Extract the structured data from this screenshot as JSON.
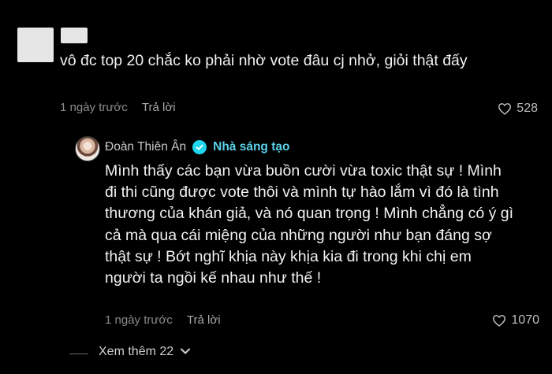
{
  "comment": {
    "text": "vô đc top 20 chắc ko phải nhờ vote đâu cj nhở, giỏi thật đấy",
    "time": "1 ngày trước",
    "reply_label": "Trả lời",
    "likes": "528",
    "like_icon": "heart-outline-icon"
  },
  "reply": {
    "author": "Đoàn Thiên Ân",
    "badge": "Nhà sáng tạo",
    "verified_icon": "verified-check-icon",
    "text": "Mình thấy các bạn vừa buồn cười vừa toxic thật sự ! Mình đi thi cũng được vote thôi và mình tự hào lắm vì đó là tình thương của khán giả, và nó quan trọng ! Mình chẳng có ý gì cả mà qua cái miệng của những người như bạn đáng sợ thật sự ! Bớt nghĩ khịa này khịa kia đi trong khi chị em người ta ngồi kế nhau như thế !",
    "time": "1 ngày trước",
    "reply_label": "Trả lời",
    "likes": "1070"
  },
  "view_more": {
    "label": "Xem thêm 22",
    "icon": "chevron-down-icon"
  },
  "colors": {
    "background": "#000000",
    "verified": "#20d5ec",
    "creator_badge": "#5bd0e8",
    "muted_text": "#8a8a8a"
  }
}
